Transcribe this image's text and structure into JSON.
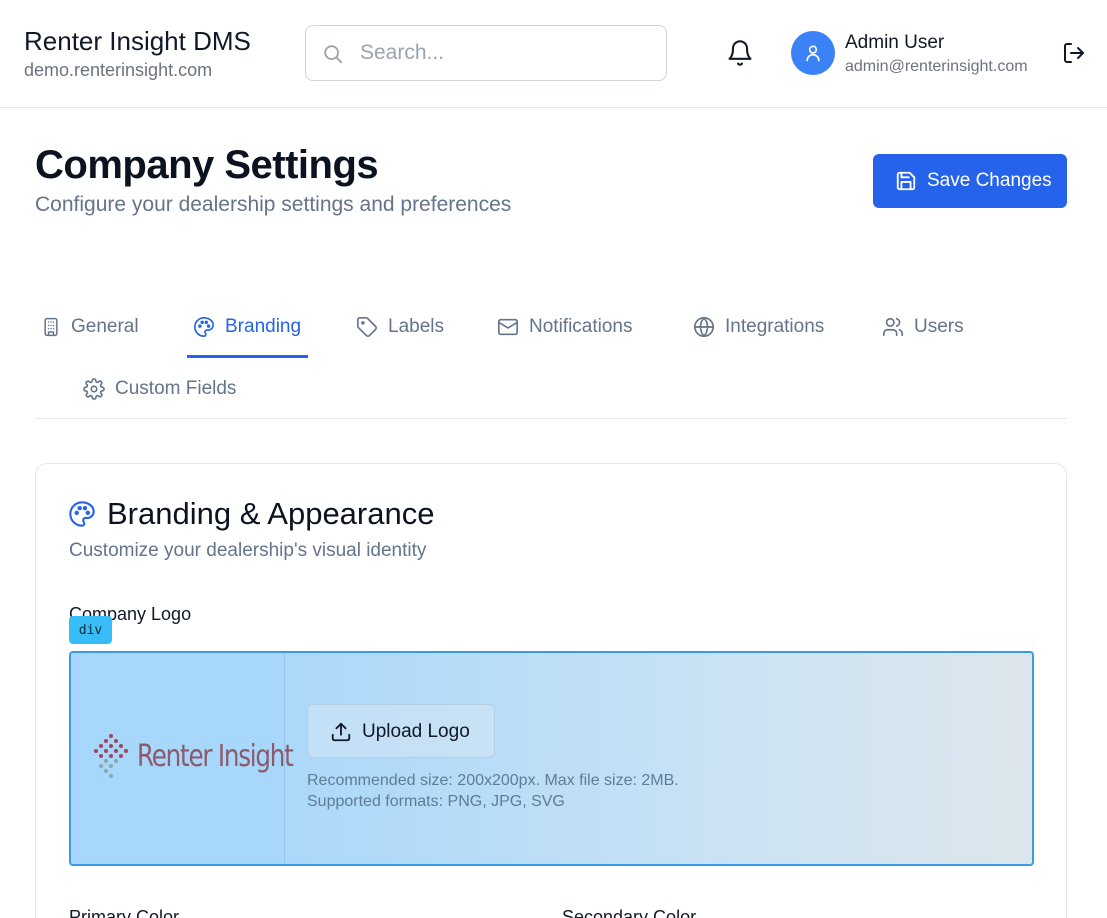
{
  "header": {
    "app_name": "Renter Insight DMS",
    "domain": "demo.renterinsight.com",
    "search_placeholder": "Search...",
    "user_name": "Admin User",
    "user_email": "admin@renterinsight.com",
    "icons": [
      "search-icon",
      "bell-icon",
      "user-icon",
      "logout-icon"
    ]
  },
  "page": {
    "title": "Company Settings",
    "subtitle": "Configure your dealership settings and preferences",
    "save_label": "Save Changes"
  },
  "tabs": [
    {
      "label": "General",
      "icon": "building-icon",
      "active": false
    },
    {
      "label": "Branding",
      "icon": "palette-icon",
      "active": true
    },
    {
      "label": "Labels",
      "icon": "tag-icon",
      "active": false
    },
    {
      "label": "Notifications",
      "icon": "mail-icon",
      "active": false
    },
    {
      "label": "Integrations",
      "icon": "globe-icon",
      "active": false
    },
    {
      "label": "Users",
      "icon": "users-icon",
      "active": false
    },
    {
      "label": "Custom Fields",
      "icon": "gear-icon",
      "active": false
    }
  ],
  "branding": {
    "title": "Branding & Appearance",
    "subtitle": "Customize your dealership's visual identity",
    "logo_label": "Company Logo",
    "element_tag": "div",
    "logo_text": "Renter Insight",
    "upload_label": "Upload Logo",
    "hint_size": "Recommended size: 200x200px. Max file size: 2MB.",
    "hint_formats": "Supported formats: PNG, JPG, SVG",
    "primary_color_label": "Primary Color",
    "secondary_color_label": "Secondary Color"
  },
  "colors": {
    "accent": "#2563eb",
    "avatar": "#3b82f6",
    "logo_text": "#8b5a6b",
    "highlight_border": "#3b9ae8"
  }
}
